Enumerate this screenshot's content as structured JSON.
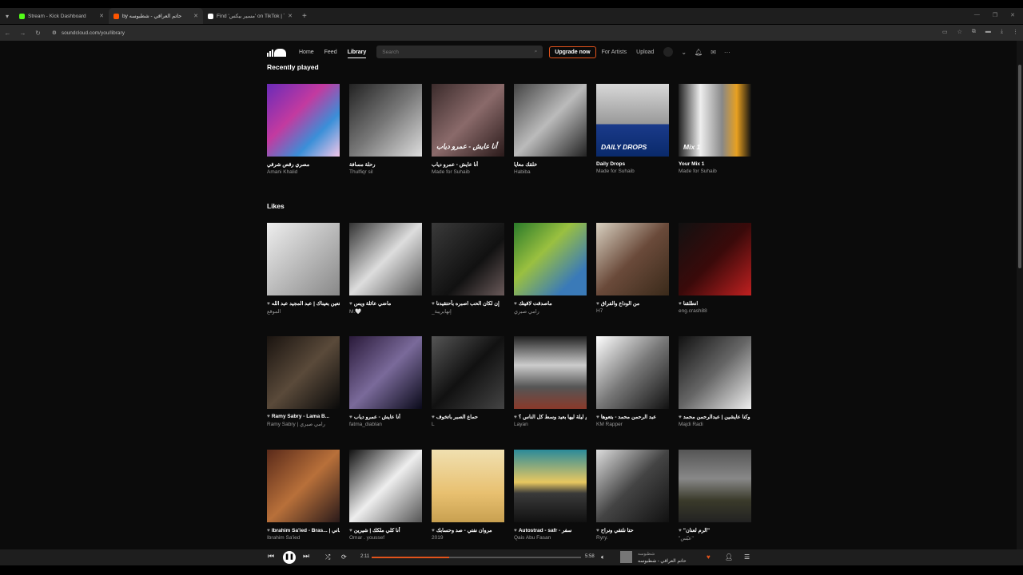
{
  "browser": {
    "tabs": [
      {
        "title": "Stream - Kick Dashboard",
        "icon": "kick-icon",
        "color": "#53fc18"
      },
      {
        "title": "by حاتم العراقي - شطبوسه",
        "icon": "soundcloud-icon",
        "color": "#ff5500"
      },
      {
        "title": "Find 'مسير بيكس' on TikTok | Til",
        "icon": "tiktok-icon",
        "color": "#ffffff"
      }
    ],
    "new_tab": "+",
    "url": "soundcloud.com/you/library"
  },
  "header": {
    "nav": [
      "Home",
      "Feed",
      "Library"
    ],
    "search_placeholder": "Search",
    "upgrade": "Upgrade now",
    "for_artists": "For Artists",
    "upload": "Upload"
  },
  "recently_played": {
    "title": "Recently played",
    "items": [
      {
        "title": "مصري رقص شرقي",
        "sub": "Amani Khalid",
        "art": "linear-gradient(135deg,#6a2bb8,#c33aa0 40%,#3a8fd8 70%,#f2c6e8)",
        "label": ""
      },
      {
        "title": "رحلة مسافة",
        "sub": "Thulfiqr sil",
        "art": "linear-gradient(135deg,#222,#777 50%,#ddd)",
        "label": ""
      },
      {
        "title": "أنا عايش - عمرو دياب",
        "sub": "Made for Suhaib",
        "art": "linear-gradient(135deg,#3b2b2b,#8a6a6a 50%,#2a1a1a)",
        "label": "أنا عايش - عمرو دياب"
      },
      {
        "title": "خلقك معايا",
        "sub": "Habiba",
        "art": "linear-gradient(135deg,#444,#bbb 50%,#222)",
        "label": ""
      },
      {
        "title": "Daily Drops",
        "sub": "Made for Suhaib",
        "art": "linear-gradient(180deg,#d8d8d8 0%,#999 55%,#1a3a8a 56%,#0a2a6a)",
        "label": "DAILY DROPS"
      },
      {
        "title": "Your Mix 1",
        "sub": "Made for Suhaib",
        "art": "linear-gradient(90deg,#222 0%,#eee 30%,#888 60%,#e8a020 80%,#111)",
        "label": "Mix 1"
      }
    ]
  },
  "likes": {
    "title": "Likes",
    "rows": [
      [
        {
          "title": "متعين بعيناك | عبد المجيد عبد الله",
          "sub": "الموقع",
          "art": "linear-gradient(135deg,#eee,#bbb 50%,#888)"
        },
        {
          "title": "ماضي عائلة ويس",
          "sub": "M.🤍",
          "art": "linear-gradient(135deg,#333,#ddd 50%,#555)"
        },
        {
          "title": "إن لكان الحب اصبره بأحتقيدنا",
          "sub": "_إنهابريبة",
          "art": "linear-gradient(135deg,#3a3a3a,#111 60%,#6a5a5a)"
        },
        {
          "title": "ماصدقت لاقيتك",
          "sub": "رامي صبري",
          "art": "linear-gradient(135deg,#2a7a2a,#9ac040 40%,#3a7ab8 80%)"
        },
        {
          "title": "من الوداع والفراق",
          "sub": "H7",
          "art": "linear-gradient(135deg,#d8d0c0,#6a4a3a 50%,#3a2a1a)"
        },
        {
          "title": "انطلقنا",
          "sub": "eng.crash88",
          "art": "linear-gradient(135deg,#111,#3a0a0a 50%,#c02020)"
        }
      ],
      [
        {
          "title": "Ramy Sabry - Lama B...",
          "sub": "Ramy Sabry | رامي صبري",
          "art": "linear-gradient(135deg,#1a1410,#5a4a3a 50%,#0a0a0a)"
        },
        {
          "title": "أنا عايش - عمرو دياب",
          "sub": "fatma_diablan",
          "art": "linear-gradient(135deg,#2a1a3a,#7a6a9a 50%,#0a0a1a)"
        },
        {
          "title": "حماع الصبر باتخوف",
          "sub": "L",
          "art": "linear-gradient(135deg,#555,#111 50%,#444)"
        },
        {
          "title": "ام ليلة ليها بعيد وسط كل الناس ؟",
          "sub": "Layan",
          "art": "linear-gradient(180deg,#222,#ccc 40%,#555 70%,#8a3a2a)"
        },
        {
          "title": "عبد الرحمن محمد - بتعوها",
          "sub": "KM Rapper",
          "art": "linear-gradient(135deg,#fff,#777 50%,#111)"
        },
        {
          "title": "وكنا عايشين | عبدالرحمن محمد",
          "sub": "Majdi Radi",
          "art": "linear-gradient(135deg,#111,#666 50%,#eee)"
        }
      ],
      [
        {
          "title": "Ibrahim Sa'ied - Bras... | ياسين عوده انتوه وأغاني",
          "sub": "Ibrahim Sa'ied",
          "art": "linear-gradient(135deg,#5a2a1a,#b8703a 50%,#2a1a1a)"
        },
        {
          "title": "أنا كلي ملكك | شيرين",
          "sub": "Omar . youssef",
          "art": "linear-gradient(135deg,#111,#eee 50%,#555)"
        },
        {
          "title": "مروان نفتي - صد وحسابك",
          "sub": "2019",
          "art": "linear-gradient(180deg,#f0e0b0,#e8c070 60%,#c8a050)"
        },
        {
          "title": "Autostrad - safr - سفر",
          "sub": "Qais Abu Fasan",
          "art": "linear-gradient(180deg,#2a8a9a,#e8c860 45%,#3a3a3a 60%,#111)"
        },
        {
          "title": "حتا نلتقي ونراح",
          "sub": "Ryry.",
          "art": "linear-gradient(135deg,#ddd,#444 50%,#111)"
        },
        {
          "title": "\"الرم لعنان\"",
          "sub": "\"عبّس\"",
          "art": "linear-gradient(180deg,#555,#888 40%,#3a3a2a 70%,#222)"
        }
      ]
    ]
  },
  "player": {
    "elapsed": "2:11",
    "duration": "5:58",
    "progress_percent": 37,
    "track_artist": "شطبوسه",
    "track_title": "حاتم العراقي - شطبوسه",
    "accent": "#e2531b"
  }
}
